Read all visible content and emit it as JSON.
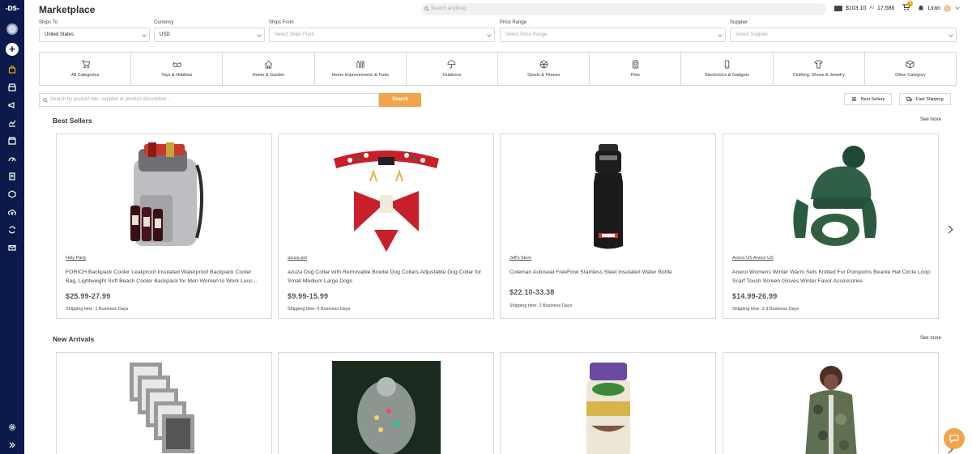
{
  "app": {
    "logo": "-DS-",
    "title": "Marketplace"
  },
  "header": {
    "search_placeholder": "Search anything",
    "balance": "$103.10",
    "points": "17,586",
    "cart_count": "3",
    "user_name": "Liran"
  },
  "filters": {
    "ships_to": {
      "label": "Ships To",
      "value": "United States"
    },
    "currency": {
      "label": "Currency",
      "value": "USD"
    },
    "ships_from": {
      "label": "Ships From",
      "placeholder": "Select Ships From"
    },
    "price_range": {
      "label": "Price Range",
      "placeholder": "Select Price Range"
    },
    "supplier": {
      "label": "Supplier",
      "placeholder": "Select Supplier"
    }
  },
  "categories": [
    {
      "label": "All Categories",
      "icon": "cart-icon"
    },
    {
      "label": "Toys & Hobbies",
      "icon": "glasses-icon"
    },
    {
      "label": "Home & Garden",
      "icon": "home-icon"
    },
    {
      "label": "Home Improvements & Tools",
      "icon": "tools-icon"
    },
    {
      "label": "Outdoors",
      "icon": "umbrella-icon"
    },
    {
      "label": "Sports & Fitness",
      "icon": "ball-icon"
    },
    {
      "label": "Pets",
      "icon": "pet-icon"
    },
    {
      "label": "Electronics & Gadgets",
      "icon": "phone-icon"
    },
    {
      "label": "Clothing, Shoes & Jewelry",
      "icon": "shirt-icon"
    },
    {
      "label": "Other Category",
      "icon": "box-icon"
    }
  ],
  "product_search": {
    "placeholder": "Search by product title, supplier or product description...",
    "button": "Search"
  },
  "toggles": {
    "best_sellers": "Best Sellers",
    "fast_shipping": "Fast Shipping"
  },
  "best_sellers": {
    "title": "Best Sellers",
    "see_more": "See more",
    "products": [
      {
        "supplier": "Holy Party",
        "title": "FORICH Backpack Cooler Leakproof Insulated Waterproof Backpack Cooler Bag, Lightweight Soft Beach Cooler Backpack for Men Women to Work Lunc...",
        "price": "$25.99-27.99",
        "shipping": "Shipping time: 1 Business Days"
      },
      {
        "supplier": "azuza pet",
        "title": "azuza Dog Collar with Removable Bowtie Dog Collars Adjustable Dog Collar for Small Medium Large Dogs",
        "price": "$9.99-15.99",
        "shipping": "Shipping time: 6 Business Days"
      },
      {
        "supplier": "Jeff's Store",
        "title": "Coleman Autoseal FreeFlow Stainless Steel Insulated Water Bottle",
        "price": "$22.10-33.38",
        "shipping": "Shipping time: 2 Business Days"
      },
      {
        "supplier": "Aneco US Aneco US",
        "title": "Aneco Womens Winter Warm Sets Knitted Fur Pompoms Beanie Hat Circle Loop Scarf Touch Screen Gloves Winter Favor Accessories",
        "price": "$14.99-26.99",
        "shipping": "Shipping time: 2-3 Business Days"
      }
    ]
  },
  "new_arrivals": {
    "title": "New Arrivals",
    "see_more": "See more"
  },
  "colors": {
    "sidebar": "#0b1a4a",
    "accent": "#f0a54a"
  }
}
